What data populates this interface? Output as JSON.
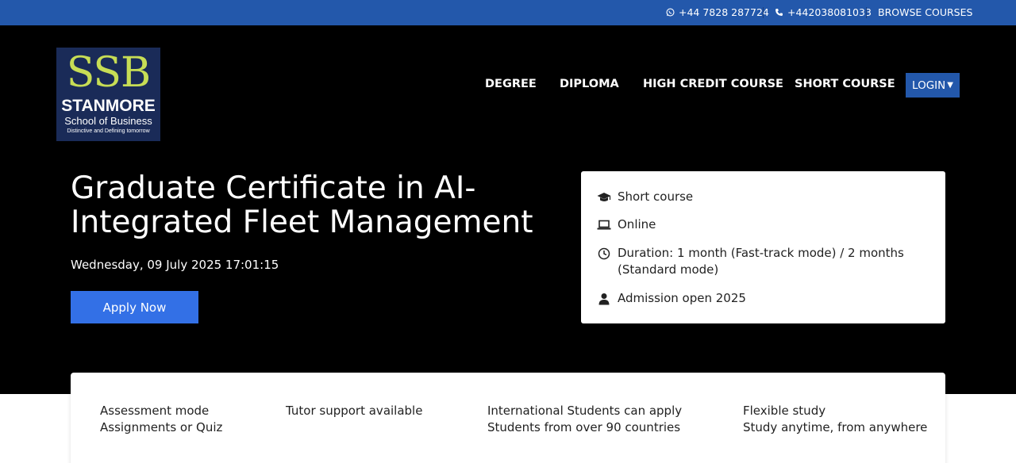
{
  "topbar": {
    "whatsapp": "+44 7828 287724",
    "phone": "+442038081033",
    "browse": "BROWSE COURSES"
  },
  "logo": {
    "line1": "SSB",
    "line2": "STANMORE",
    "line3": "School of Business",
    "line4": "Distinctive and Defining tomorrow"
  },
  "nav": {
    "degree": "DEGREE",
    "diploma": "DIPLOMA",
    "high_credit": "HIGH CREDIT COURSE",
    "short_course": "SHORT COURSE",
    "login": "LOGIN"
  },
  "hero": {
    "title": "Graduate Certificate in AI-Integrated Fleet Management",
    "datetime": "Wednesday, 09 July 2025 17:01:15",
    "apply": "Apply Now"
  },
  "info": {
    "type": "Short course",
    "mode": "Online",
    "duration": "Duration: 1 month (Fast-track mode) / 2 months (Standard mode)",
    "admission": "Admission open 2025"
  },
  "features": [
    {
      "title": "Assessment mode",
      "sub": "Assignments or Quiz"
    },
    {
      "title": "Tutor support available",
      "sub": ""
    },
    {
      "title": "International Students can apply",
      "sub": "Students from over 90 countries"
    },
    {
      "title": "Flexible study",
      "sub": "Study anytime, from anywhere"
    }
  ],
  "colors": {
    "topbar": "#2358ab",
    "hero_bg": "#000000",
    "apply_button": "#3370e6",
    "logo_bg": "#1a2b58",
    "logo_accent": "#c7dd55"
  }
}
